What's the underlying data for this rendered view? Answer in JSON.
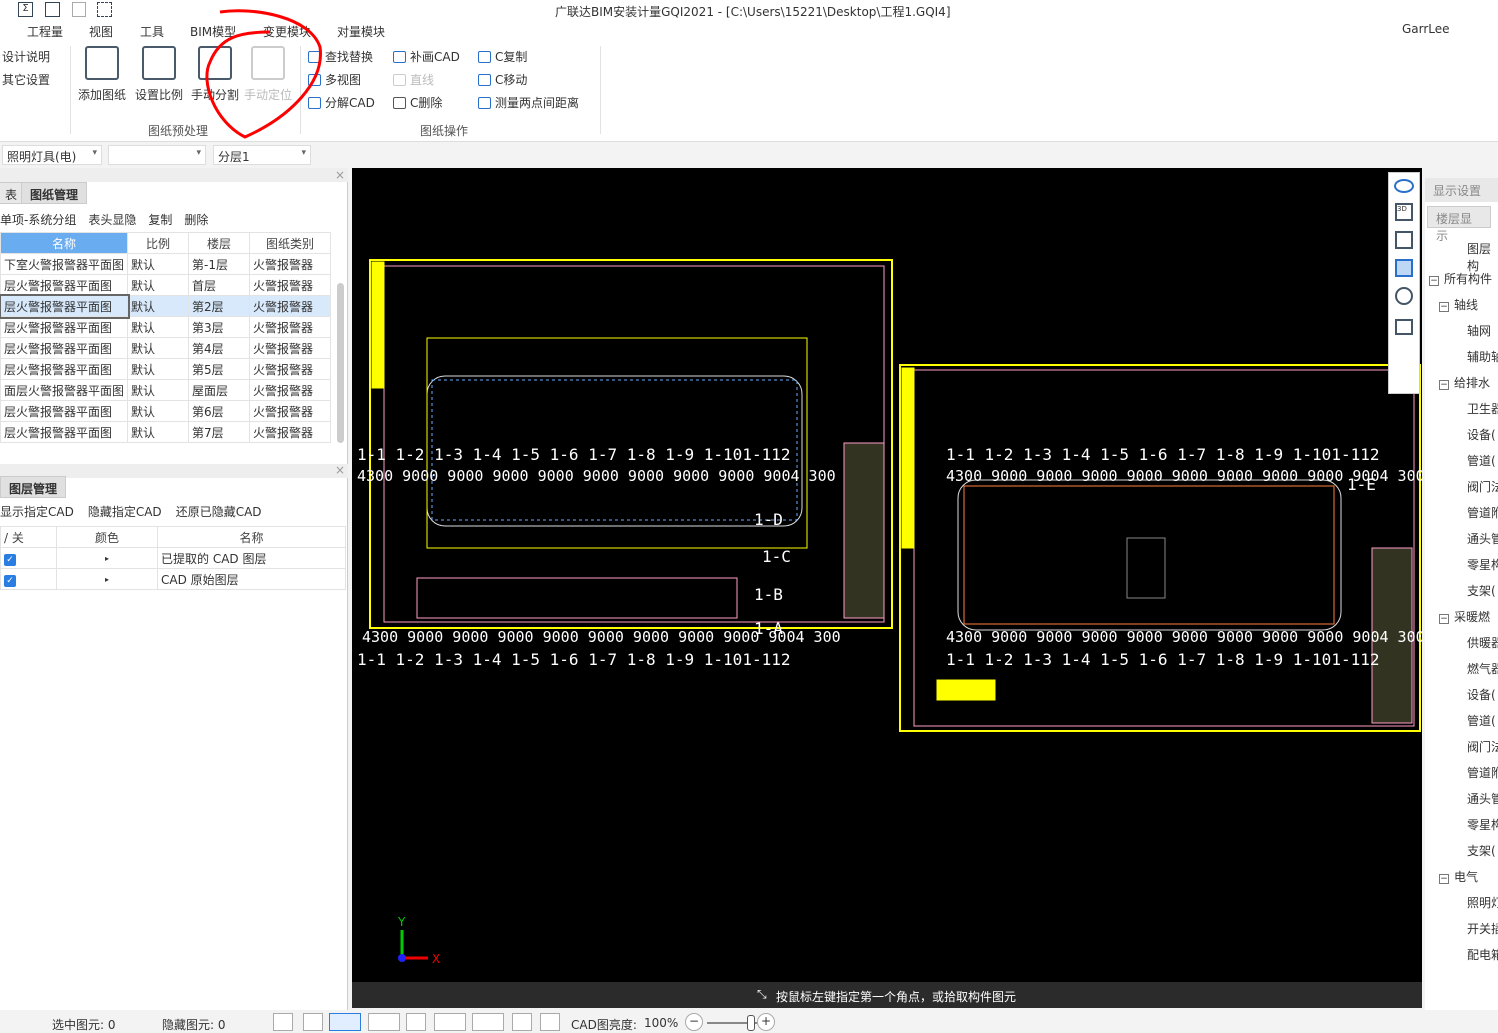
{
  "window": {
    "title": "广联达BIM安装计量GQI2021 - [C:\\Users\\15221\\Desktop\\工程1.GQI4]",
    "user": "GarrLee"
  },
  "menu": [
    "工程量",
    "视图",
    "工具",
    "BIM模型",
    "变更模块",
    "对量模块"
  ],
  "ribbon": {
    "left_items": [
      "设计说明",
      "其它设置"
    ],
    "big_buttons": [
      {
        "label": "添加图纸",
        "enabled": true
      },
      {
        "label": "设置比例",
        "enabled": true
      },
      {
        "label": "手动分割",
        "enabled": true
      },
      {
        "label": "手动定位",
        "enabled": false
      }
    ],
    "group1": "图纸预处理",
    "small_buttons": [
      {
        "label": "查找替换",
        "enabled": true
      },
      {
        "label": "多视图",
        "enabled": true
      },
      {
        "label": "分解CAD",
        "enabled": true
      },
      {
        "label": "补画CAD",
        "enabled": true
      },
      {
        "label": "直线",
        "enabled": false
      },
      {
        "label": "C删除",
        "enabled": true
      },
      {
        "label": "C复制",
        "enabled": true
      },
      {
        "label": "C移动",
        "enabled": true
      },
      {
        "label": "测量两点间距离",
        "enabled": true
      }
    ],
    "group2": "图纸操作"
  },
  "combos": [
    "照明灯具(电)",
    "",
    "分层1"
  ],
  "drawing_panel": {
    "tabs": [
      "表",
      "图纸管理"
    ],
    "toolbar": [
      "单项-系统分组",
      "表头显隐",
      "复制",
      "删除"
    ],
    "columns": [
      "名称",
      "比例",
      "楼层",
      "图纸类别"
    ],
    "rows": [
      [
        "下室火警报警器平面图",
        "默认",
        "第-1层",
        "火警报警器"
      ],
      [
        "层火警报警器平面图",
        "默认",
        "首层",
        "火警报警器"
      ],
      [
        "层火警报警器平面图",
        "默认",
        "第2层",
        "火警报警器"
      ],
      [
        "层火警报警器平面图",
        "默认",
        "第3层",
        "火警报警器"
      ],
      [
        "层火警报警器平面图",
        "默认",
        "第4层",
        "火警报警器"
      ],
      [
        "层火警报警器平面图",
        "默认",
        "第5层",
        "火警报警器"
      ],
      [
        "面层火警报警器平面图",
        "默认",
        "屋面层",
        "火警报警器"
      ],
      [
        "层火警报警器平面图",
        "默认",
        "第6层",
        "火警报警器"
      ],
      [
        "层火警报警器平面图",
        "默认",
        "第7层",
        "火警报警器"
      ]
    ]
  },
  "layer_panel": {
    "tab": "图层管理",
    "toolbar": [
      "显示指定CAD",
      "隐藏指定CAD",
      "还原已隐藏CAD"
    ],
    "columns": [
      "/ 关",
      "颜色",
      "名称"
    ],
    "rows": [
      {
        "checked": true,
        "name": "已提取的 CAD 图层"
      },
      {
        "checked": true,
        "name": "CAD 原始图层"
      }
    ]
  },
  "canvas": {
    "axis_top": "1-1 1-2  1-3  1-4  1-5  1-6  1-7  1-8  1-9 1-101-112",
    "dims": "4300 9000 9000 9000 9000 9000 9000 9000 9000 9004 300",
    "axis_side": [
      "1-E",
      "1-D",
      "1-C",
      "1-B",
      "1-A"
    ],
    "ucs": {
      "x": "X",
      "y": "Y"
    }
  },
  "command_prompt": "按鼠标左键指定第一个角点，或拾取构件图元",
  "right_panel": {
    "tabs": [
      "显示设置",
      "楼层显示"
    ],
    "header": "图层构",
    "tree": [
      {
        "label": "所有构件",
        "level": 0,
        "group": true
      },
      {
        "label": "轴线",
        "level": 1,
        "group": true
      },
      {
        "label": "轴网",
        "level": 2
      },
      {
        "label": "辅助轴",
        "level": 2
      },
      {
        "label": "给排水",
        "level": 1,
        "group": true
      },
      {
        "label": "卫生器",
        "level": 2
      },
      {
        "label": "设备(",
        "level": 2
      },
      {
        "label": "管道(",
        "level": 2
      },
      {
        "label": "阀门法",
        "level": 2
      },
      {
        "label": "管道附",
        "level": 2
      },
      {
        "label": "通头管",
        "level": 2
      },
      {
        "label": "零星构",
        "level": 2
      },
      {
        "label": "支架(",
        "level": 2
      },
      {
        "label": "采暖燃",
        "level": 1,
        "group": true
      },
      {
        "label": "供暖器",
        "level": 2
      },
      {
        "label": "燃气器",
        "level": 2
      },
      {
        "label": "设备(",
        "level": 2
      },
      {
        "label": "管道(",
        "level": 2
      },
      {
        "label": "阀门法",
        "level": 2
      },
      {
        "label": "管道附",
        "level": 2
      },
      {
        "label": "通头管",
        "level": 2
      },
      {
        "label": "零星构",
        "level": 2
      },
      {
        "label": "支架(",
        "level": 2
      },
      {
        "label": "电气",
        "level": 1,
        "group": true
      },
      {
        "label": "照明灯",
        "level": 2
      },
      {
        "label": "开关插",
        "level": 2
      },
      {
        "label": "配电箱",
        "level": 2
      }
    ]
  },
  "status": {
    "selected": "选中图元: 0",
    "hidden": "隐藏图元: 0",
    "brightness_label": "CAD图亮度:",
    "brightness": "100%",
    "brightness_value": 100
  },
  "colors": {
    "accent": "#2a7de1",
    "cad_yellow": "#ffff00",
    "cad_pink": "#ff9ec8",
    "annotation_red": "#ff0000"
  }
}
